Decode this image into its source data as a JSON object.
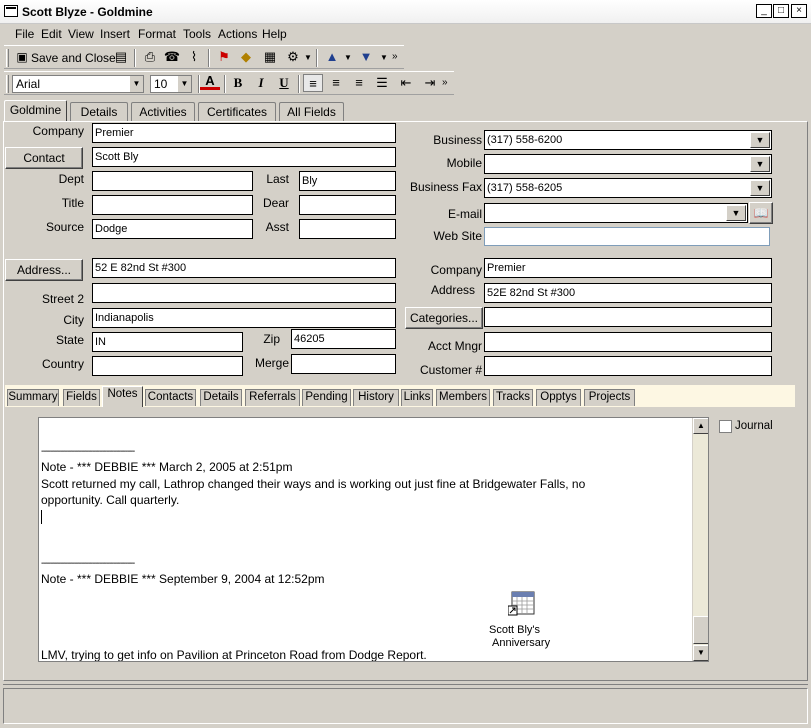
{
  "window": {
    "title": "Scott Blyze - Goldmine"
  },
  "menu": [
    "File",
    "Edit",
    "View",
    "Insert",
    "Format",
    "Tools",
    "Actions",
    "Help"
  ],
  "toolbar": {
    "save_close_label": "Save and Close"
  },
  "format_toolbar": {
    "font": "Arial",
    "size": "10"
  },
  "top_tabs": [
    "Goldmine",
    "Details",
    "Activities",
    "Certificates",
    "All Fields"
  ],
  "contact": {
    "company_label": "Company",
    "company": "Premier",
    "contact_button": "Contact",
    "contact": "Scott Bly",
    "dept_label": "Dept",
    "dept": "",
    "last_label": "Last",
    "last": "Bly",
    "title_label": "Title",
    "title": "",
    "dear_label": "Dear",
    "dear": "",
    "source_label": "Source",
    "source": "Dodge",
    "asst_label": "Asst",
    "asst": ""
  },
  "phones": {
    "business_label": "Business",
    "business": "(317) 558-6200",
    "mobile_label": "Mobile",
    "mobile": "",
    "fax_label": "Business Fax",
    "fax": "(317) 558-6205",
    "email_label": "E-mail",
    "email": "",
    "website_label": "Web Site",
    "website": ""
  },
  "address": {
    "address_button": "Address...",
    "address": "52 E 82nd St #300",
    "street2_label": "Street 2",
    "street2": "",
    "city_label": "City",
    "city": "Indianapolis",
    "state_label": "State",
    "state": "IN",
    "zip_label": "Zip",
    "zip": "46205",
    "country_label": "Country",
    "country": "",
    "merge_label": "Merge",
    "merge": ""
  },
  "company_block": {
    "company_label": "Company",
    "company": "Premier",
    "address_label": "Address",
    "address": "52E 82nd St #300",
    "categories_button": "Categories...",
    "categories": "",
    "acct_mngr_label": "Acct Mngr",
    "acct_mngr": "",
    "customer_label": "Customer #",
    "customer": ""
  },
  "lower_tabs": [
    "Summary",
    "Fields",
    "Notes",
    "Contacts",
    "Details",
    "Referrals",
    "Pending",
    "History",
    "Links",
    "Members",
    "Tracks",
    "Opptys",
    "Projects"
  ],
  "journal_label": "Journal",
  "notes": {
    "divider": "----------------------------------------",
    "note1_header": "Note - *** DEBBIE ***  March 2, 2005 at  2:51pm",
    "note1_body1": " Scott returned my call, Lathrop changed their ways and is working out just fine at Bridgewater Falls, no",
    "note1_body2": "opportunity. Call quarterly.",
    "note2_header": "Note - *** DEBBIE ***  September 9, 2004 at 12:52pm",
    "note2_body": " LMV, trying to get info on Pavilion at Princeton Road from Dodge Report.",
    "attachment_label1": "Scott Bly's",
    "attachment_label2": "Anniversary"
  }
}
